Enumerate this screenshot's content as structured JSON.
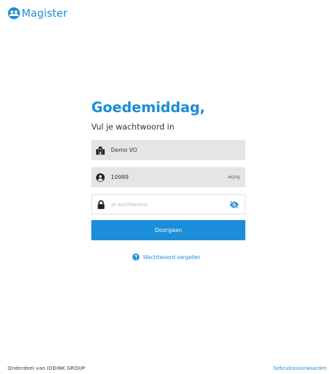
{
  "brand": {
    "name": "Magister",
    "logo_icon": "users-circle-icon",
    "accent_color": "#1c8dd8"
  },
  "login": {
    "greeting": "Goedemiddag,",
    "subtitle": "Vul je wachtwoord in",
    "school": {
      "icon": "school-building-icon",
      "value": "Demo VO"
    },
    "username": {
      "icon": "user-circle-icon",
      "value": "10989",
      "edit_label": "wijzig"
    },
    "password": {
      "icon": "lock-icon",
      "placeholder": "Je wachtwoord",
      "toggle_icon": "eye-slash-icon"
    },
    "submit_label": "Doorgaan",
    "forgot": {
      "icon": "question-circle-icon",
      "label": "Wachtwoord vergeten"
    }
  },
  "footer": {
    "company": "Onderdeel van IDDINK GROUP",
    "terms_link": "Gebruiksvoorwaarden"
  }
}
